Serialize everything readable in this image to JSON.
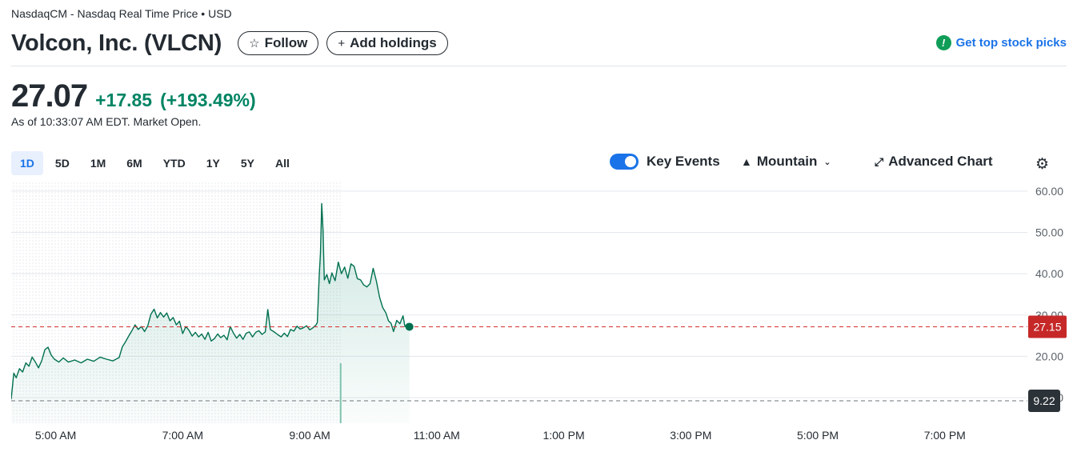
{
  "header": {
    "exchange": "NasdaqCM - Nasdaq Real Time Price • USD",
    "company": "Volcon, Inc. (VLCN)",
    "follow_label": "Follow",
    "add_holdings_label": "Add holdings",
    "top_picks_label": "Get top stock picks"
  },
  "quote": {
    "price": "27.07",
    "change": "+17.85",
    "change_pct": "(+193.49%)",
    "as_of": "As of 10:33:07 AM EDT. Market Open."
  },
  "ranges": [
    "1D",
    "5D",
    "1M",
    "6M",
    "YTD",
    "1Y",
    "5Y",
    "All"
  ],
  "active_range": "1D",
  "tools": {
    "key_events_label": "Key Events",
    "key_events_on": true,
    "chart_type_label": "Mountain",
    "advanced_label": "Advanced Chart"
  },
  "colors": {
    "up": "#008463",
    "accent": "#1a73e8",
    "current_line": "#d32f2f",
    "prev_close_badge": "#2b3238"
  },
  "chart_data": {
    "type": "area",
    "x_unit": "hours (ET, 24h clock)",
    "y_ticks": [
      60,
      50,
      40,
      30,
      20,
      10
    ],
    "y_tick_labels": [
      "60.00",
      "50.00",
      "40.00",
      "30.00",
      "20.00",
      "10.00"
    ],
    "x_ticks": [
      5,
      7,
      9,
      11,
      13,
      15,
      17,
      19
    ],
    "x_tick_labels": [
      "5:00 AM",
      "7:00 AM",
      "9:00 AM",
      "11:00 AM",
      "1:00 PM",
      "3:00 PM",
      "5:00 PM",
      "7:00 PM"
    ],
    "xlim": [
      4.3,
      20.25
    ],
    "ylim": [
      3.8,
      62.5
    ],
    "current_price": 27.15,
    "current_price_label": "27.15",
    "previous_close": 9.22,
    "previous_close_label": "9.22",
    "premarket_end": 9.5,
    "series": [
      {
        "values": [
          [
            4.3,
            9.6
          ],
          [
            4.34,
            15.9
          ],
          [
            4.38,
            14.8
          ],
          [
            4.43,
            17.0
          ],
          [
            4.48,
            16.2
          ],
          [
            4.53,
            18.4
          ],
          [
            4.58,
            17.6
          ],
          [
            4.63,
            19.8
          ],
          [
            4.68,
            18.6
          ],
          [
            4.73,
            17.2
          ],
          [
            4.78,
            18.9
          ],
          [
            4.83,
            21.6
          ],
          [
            4.88,
            22.2
          ],
          [
            4.93,
            20.3
          ],
          [
            4.98,
            19.3
          ],
          [
            5.05,
            18.6
          ],
          [
            5.12,
            19.6
          ],
          [
            5.2,
            18.6
          ],
          [
            5.3,
            19.1
          ],
          [
            5.4,
            18.4
          ],
          [
            5.5,
            19.3
          ],
          [
            5.6,
            18.8
          ],
          [
            5.7,
            19.8
          ],
          [
            5.8,
            19.3
          ],
          [
            5.9,
            18.9
          ],
          [
            6.0,
            19.7
          ],
          [
            6.05,
            22.3
          ],
          [
            6.1,
            23.5
          ],
          [
            6.15,
            24.9
          ],
          [
            6.2,
            26.2
          ],
          [
            6.25,
            27.6
          ],
          [
            6.3,
            26.5
          ],
          [
            6.35,
            27.2
          ],
          [
            6.4,
            26.0
          ],
          [
            6.45,
            27.4
          ],
          [
            6.5,
            30.2
          ],
          [
            6.55,
            31.4
          ],
          [
            6.6,
            29.3
          ],
          [
            6.65,
            30.6
          ],
          [
            6.7,
            29.5
          ],
          [
            6.75,
            30.5
          ],
          [
            6.8,
            28.6
          ],
          [
            6.85,
            29.4
          ],
          [
            6.9,
            27.6
          ],
          [
            6.95,
            28.5
          ],
          [
            7.0,
            25.5
          ],
          [
            7.05,
            27.2
          ],
          [
            7.1,
            26.3
          ],
          [
            7.15,
            24.9
          ],
          [
            7.2,
            25.8
          ],
          [
            7.25,
            24.7
          ],
          [
            7.3,
            25.4
          ],
          [
            7.35,
            24.1
          ],
          [
            7.4,
            25.8
          ],
          [
            7.45,
            23.7
          ],
          [
            7.5,
            24.3
          ],
          [
            7.55,
            25.4
          ],
          [
            7.6,
            24.5
          ],
          [
            7.65,
            25.1
          ],
          [
            7.7,
            24.0
          ],
          [
            7.75,
            27.2
          ],
          [
            7.8,
            25.6
          ],
          [
            7.85,
            24.4
          ],
          [
            7.9,
            25.3
          ],
          [
            7.95,
            24.1
          ],
          [
            8.0,
            25.6
          ],
          [
            8.05,
            25.9
          ],
          [
            8.1,
            24.7
          ],
          [
            8.15,
            25.8
          ],
          [
            8.2,
            26.2
          ],
          [
            8.25,
            25.3
          ],
          [
            8.3,
            25.9
          ],
          [
            8.34,
            31.3
          ],
          [
            8.38,
            26.5
          ],
          [
            8.45,
            25.8
          ],
          [
            8.5,
            25.2
          ],
          [
            8.55,
            24.7
          ],
          [
            8.6,
            25.6
          ],
          [
            8.65,
            24.8
          ],
          [
            8.7,
            26.5
          ],
          [
            8.75,
            26.1
          ],
          [
            8.8,
            27.3
          ],
          [
            8.85,
            26.6
          ],
          [
            8.9,
            26.9
          ],
          [
            8.95,
            27.4
          ],
          [
            9.0,
            26.4
          ],
          [
            9.05,
            26.9
          ],
          [
            9.1,
            27.6
          ],
          [
            9.12,
            28.2
          ],
          [
            9.15,
            39.7
          ],
          [
            9.17,
            45.0
          ],
          [
            9.19,
            57.0
          ],
          [
            9.21,
            50.5
          ],
          [
            9.23,
            38.5
          ],
          [
            9.27,
            39.8
          ],
          [
            9.31,
            37.6
          ],
          [
            9.35,
            40.2
          ],
          [
            9.4,
            38.3
          ],
          [
            9.45,
            42.8
          ],
          [
            9.5,
            40.0
          ],
          [
            9.55,
            41.6
          ],
          [
            9.6,
            38.9
          ],
          [
            9.65,
            42.4
          ],
          [
            9.7,
            41.8
          ],
          [
            9.75,
            38.8
          ],
          [
            9.8,
            38.5
          ],
          [
            9.85,
            37.3
          ],
          [
            9.9,
            36.8
          ],
          [
            9.95,
            37.6
          ],
          [
            10.0,
            41.3
          ],
          [
            10.05,
            38.2
          ],
          [
            10.1,
            34.3
          ],
          [
            10.15,
            31.8
          ],
          [
            10.2,
            30.5
          ],
          [
            10.24,
            28.6
          ],
          [
            10.28,
            28.0
          ],
          [
            10.32,
            26.0
          ],
          [
            10.37,
            28.7
          ],
          [
            10.42,
            27.9
          ],
          [
            10.47,
            29.8
          ],
          [
            10.5,
            27.2
          ],
          [
            10.54,
            27.9
          ],
          [
            10.57,
            27.07
          ]
        ]
      }
    ]
  }
}
